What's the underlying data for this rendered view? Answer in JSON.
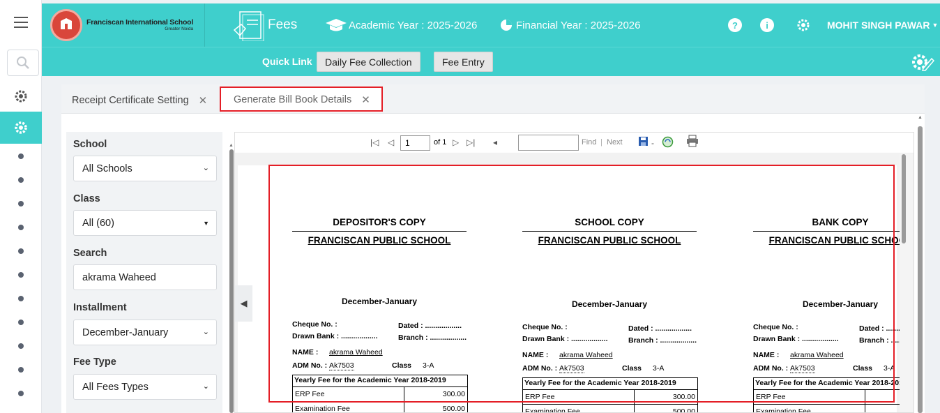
{
  "header": {
    "school_name": "Franciscan International School",
    "school_location": "Greater Noida",
    "module": "Fees",
    "academic_year": "Academic Year : 2025-2026",
    "financial_year": "Financial Year : 2025-2026",
    "user": "MOHIT SINGH PAWAR",
    "help_glyph": "?",
    "info_glyph": "i"
  },
  "quicklinks": {
    "label": "Quick Link",
    "items": [
      "Daily Fee Collection",
      "Fee Entry"
    ]
  },
  "tabs": [
    {
      "label": "Receipt Certificate Setting",
      "active": false
    },
    {
      "label": "Generate Bill Book Details",
      "active": true
    }
  ],
  "filters": {
    "school_label": "School",
    "school_value": "All Schools",
    "class_label": "Class",
    "class_value": "All (60)",
    "search_label": "Search",
    "search_value": "akrama Waheed",
    "installment_label": "Installment",
    "installment_value": "December-January",
    "feetype_label": "Fee Type",
    "feetype_value": "All Fees Types"
  },
  "viewer": {
    "page_input": "1",
    "page_of": "of 1",
    "find_placeholder": "",
    "find": "Find",
    "sep": "|",
    "next": "Next",
    "export_sep": "-"
  },
  "report": {
    "copies": [
      {
        "title": "DEPOSITOR'S COPY",
        "school": "FRANCISCAN PUBLIC SCHOOL",
        "installment": "December-January"
      },
      {
        "title": "SCHOOL COPY",
        "school": "FRANCISCAN PUBLIC SCHOOL",
        "installment": "December-January"
      },
      {
        "title": "BANK COPY",
        "school": "FRANCISCAN PUBLIC SCHOOL",
        "installment": "December-January"
      }
    ],
    "cheque": "Cheque No. :",
    "dated": "Dated : ..................",
    "drawn_bank": "Drawn Bank : ..................",
    "branch": "Branch : ..................",
    "name_label": "NAME  :",
    "name_value": "akrama Waheed",
    "adm_label": "ADM No. :",
    "adm_value": "Ak7503",
    "class_label": "Class",
    "class_value": "3-A",
    "fee_title": "Yearly Fee for the Academic Year 2018-2019",
    "fees": [
      {
        "name": "ERP Fee",
        "amount": "300.00"
      },
      {
        "name": "Examination Fee",
        "amount": "500.00"
      }
    ]
  },
  "colors": {
    "accent": "#3fcfcc",
    "highlight": "#e41e26"
  }
}
